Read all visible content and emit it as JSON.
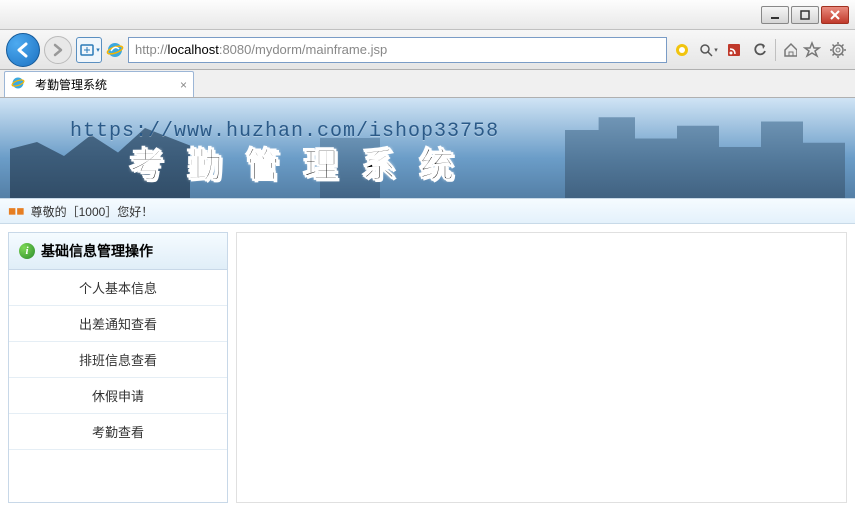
{
  "window": {
    "url_prefix": "http://",
    "url_host": "localhost",
    "url_path": ":8080/mydorm/mainframe.jsp"
  },
  "tab": {
    "title": "考勤管理系统"
  },
  "banner": {
    "url_text": "https://www.huzhan.com/ishop33758",
    "title": "考勤管理系统"
  },
  "greeting": {
    "text": "尊敬的［1000］您好！"
  },
  "sidebar": {
    "header": "基础信息管理操作",
    "items": [
      {
        "label": "个人基本信息"
      },
      {
        "label": "出差通知查看"
      },
      {
        "label": "排班信息查看"
      },
      {
        "label": "休假申请"
      },
      {
        "label": "考勤查看"
      }
    ]
  }
}
